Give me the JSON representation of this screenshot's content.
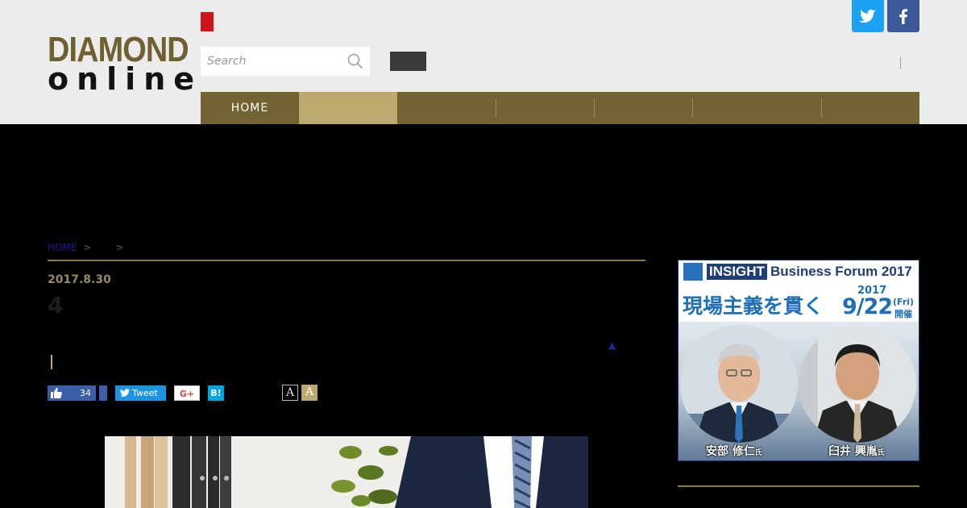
{
  "header": {
    "logo_line1": "DIAMOND",
    "logo_line2": "online",
    "search_placeholder": "Search",
    "divider": "|"
  },
  "social_top": [
    {
      "icon": "twitter-icon",
      "color": "#1da1f2"
    },
    {
      "icon": "facebook-icon",
      "color": "#3b5998"
    }
  ],
  "nav": {
    "items": [
      {
        "label": "HOME",
        "active": false
      },
      {
        "label": "",
        "active": true
      },
      {
        "label": "",
        "active": false
      },
      {
        "label": "",
        "active": false
      },
      {
        "label": "",
        "active": false
      },
      {
        "label": "",
        "active": false
      },
      {
        "label": "",
        "active": false
      }
    ]
  },
  "breadcrumb": {
    "home": "HOME",
    "separator": ">"
  },
  "article": {
    "date": "2017.8.30",
    "title": "4",
    "arrow": "▲",
    "cursor": "|"
  },
  "share": {
    "like_count": "34",
    "tweet_label": "Tweet",
    "gplus_label": "G+",
    "hatena_label": "B!"
  },
  "font_size": {
    "small_label": "A",
    "large_label": "A"
  },
  "ad": {
    "insight": "INSIGHT",
    "forum": "Business Forum 2017",
    "lead": "現場主義を貫く",
    "year": "2017",
    "date": "9/22",
    "dow": "(Fri)",
    "held": "開催",
    "speaker1": "安部 修仁",
    "speaker2": "臼井 興胤",
    "suffix": "氏"
  },
  "colors": {
    "header_bg": "#ececec",
    "nav_bg": "#726432",
    "nav_active": "#bda970",
    "page_bg": "#000000",
    "accent_gold": "#8a7a4a",
    "badge_red": "#d0121b"
  }
}
